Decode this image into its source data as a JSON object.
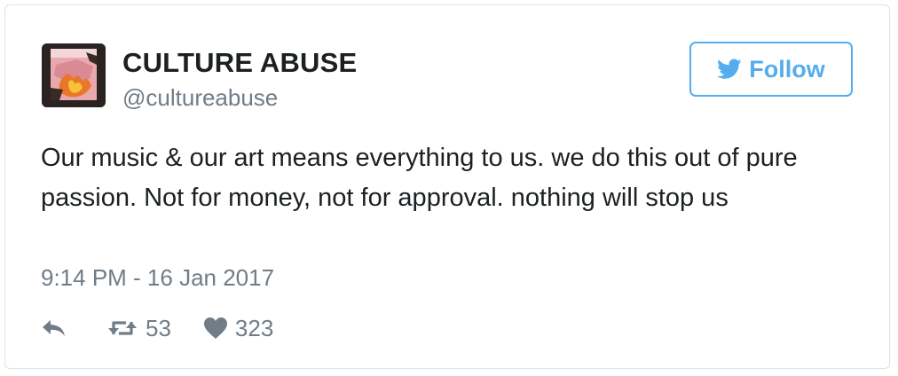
{
  "tweet": {
    "author": {
      "display_name": "CULTURE ABUSE",
      "handle": "@cultureabuse",
      "avatar_icon": "avatar-image"
    },
    "follow_button": {
      "label": "Follow",
      "icon": "twitter-bird-icon"
    },
    "text": "Our music & our art means everything to us. we do this out of pure passion. Not for money, not for approval. nothing will stop us",
    "timestamp": "9:14 PM - 16 Jan 2017",
    "actions": {
      "reply_icon": "reply-icon",
      "retweet_icon": "retweet-icon",
      "retweet_count": "53",
      "like_icon": "heart-icon",
      "like_count": "323"
    }
  },
  "colors": {
    "text": "#1c2022",
    "secondary": "#707c86",
    "accent": "#55acee",
    "border": "#dfe3e6"
  }
}
